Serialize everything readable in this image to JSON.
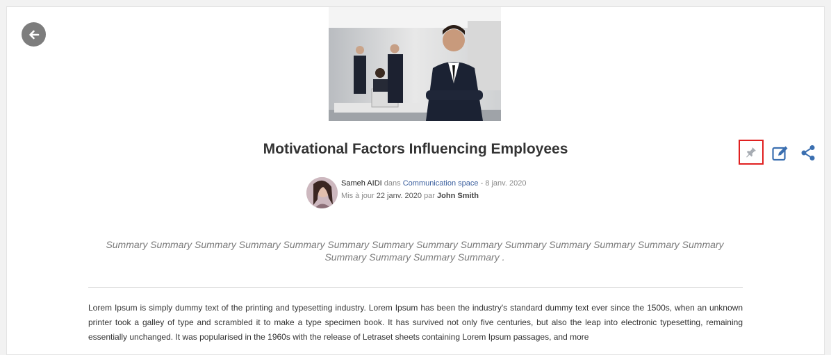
{
  "article": {
    "title": "Motivational Factors Influencing Employees",
    "author": "Sameh AIDI",
    "in_word": "dans",
    "space": "Communication space",
    "published": "- 8 janv. 2020",
    "updated_label": "Mis à jour",
    "updated_date": "22 janv. 2020",
    "by_word": "par",
    "updated_by": "John Smith",
    "summary": "Summary Summary Summary Summary Summary Summary Summary Summary Summary Summary Summary Summary Summary Summary Summary Summary Summary Summary .",
    "body": "Lorem Ipsum is simply dummy text of the printing and typesetting industry. Lorem Ipsum has been the industry's standard dummy text ever since the 1500s, when an unknown printer took a galley of type and scrambled it to make a type specimen book. It has survived not only five centuries, but also the leap into electronic typesetting, remaining essentially unchanged. It was popularised in the 1960s with the release of Letraset sheets containing Lorem Ipsum passages, and more"
  },
  "icons": {
    "back": "arrow-left-icon",
    "pin": "pin-icon",
    "edit": "edit-icon",
    "share": "share-icon"
  },
  "colors": {
    "accent": "#3b6fb0",
    "pin_highlight": "#e02020",
    "back_button": "#7d7d7d"
  }
}
